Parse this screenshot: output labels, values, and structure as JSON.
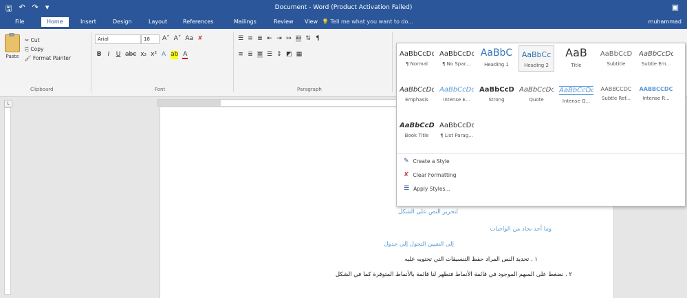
{
  "window": {
    "title": "Document - Word (Product Activation Failed)",
    "user": "muhammad"
  },
  "tabs": [
    "File",
    "Home",
    "Insert",
    "Design",
    "Layout",
    "References",
    "Mailings",
    "Review",
    "View"
  ],
  "active_tab_index": 1,
  "tell_me": "Tell me what you want to do...",
  "clipboard": {
    "paste": "Paste",
    "cut": "Cut",
    "copy": "Copy",
    "format_painter": "Format Painter",
    "group": "Clipboard"
  },
  "font": {
    "name": "Arial",
    "size": "18",
    "group": "Font"
  },
  "paragraph": {
    "group": "Paragraph"
  },
  "styles": {
    "row1": [
      {
        "preview": "AaBbCcDc",
        "name": "¶ Normal"
      },
      {
        "preview": "AaBbCcDc",
        "name": "¶ No Spac..."
      },
      {
        "preview": "AaBbC",
        "name": "Heading 1"
      },
      {
        "preview": "AaBbCc",
        "name": "Heading 2"
      },
      {
        "preview": "AaB",
        "name": "Title"
      },
      {
        "preview": "AaBbCcD",
        "name": "Subtitle"
      },
      {
        "preview": "AaBbCcDc",
        "name": "Subtle Em..."
      }
    ],
    "row2": [
      {
        "preview": "AaBbCcDc",
        "name": "Emphasis"
      },
      {
        "preview": "AaBbCcDc",
        "name": "Intense E..."
      },
      {
        "preview": "AaBbCcDc",
        "name": "Strong"
      },
      {
        "preview": "AaBbCcDc",
        "name": "Quote"
      },
      {
        "preview": "AaBbCcDc",
        "name": "Intense Q..."
      },
      {
        "preview": "AABBCCDC",
        "name": "Subtle Ref..."
      },
      {
        "preview": "AABBCCDC",
        "name": "Intense R..."
      }
    ],
    "row3": [
      {
        "preview": "AaBbCcDc",
        "name": "Book Title"
      },
      {
        "preview": "AaBbCcDc",
        "name": "¶ List Parag..."
      }
    ],
    "commands": {
      "create": "Create a Style",
      "clear": "Clear Formatting",
      "apply": "Apply Styles..."
    }
  },
  "document": {
    "lines": [
      {
        "text": "لتحرير النص على الشكل",
        "color": "blue"
      },
      {
        "text": "وما أحد نجاد من الواجبات",
        "color": "blue"
      },
      {
        "text": "إلى التعيين التجول إلى جدول",
        "color": "blue"
      },
      {
        "text": "١ . تحديد النص المراد حفظ التنسيقات التي تحتويه عليه",
        "color": "dark"
      },
      {
        "text": "٢ . نضغط على السهم الموجود في قائمة الأنماط فتظهر لنا قائمة بالأنماط المتوفرة كما في الشكل",
        "color": "dark"
      }
    ]
  }
}
